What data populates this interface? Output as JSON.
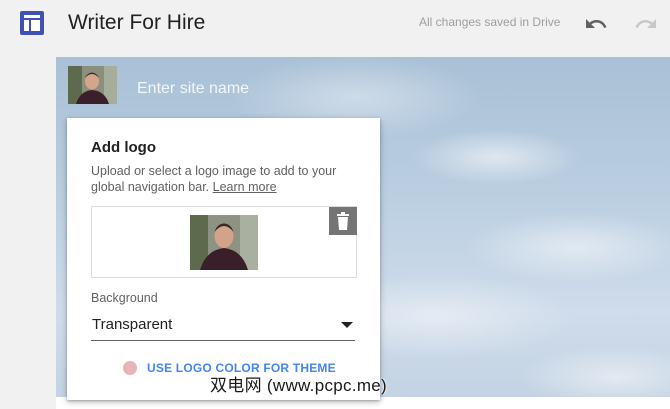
{
  "app": {
    "title": "Writer For Hire",
    "save_status": "All changes saved in Drive",
    "icons": {
      "app": "sites-layout-icon",
      "undo": "undo-icon",
      "redo": "redo-icon"
    }
  },
  "header": {
    "site_name_placeholder": "Enter site name",
    "logo_icon": "portrait-photo-icon"
  },
  "logo_panel": {
    "title": "Add logo",
    "description": "Upload or select a logo image to add to your global navigation bar.",
    "learn_more": "Learn more",
    "delete_icon": "trash-icon",
    "background_label": "Background",
    "background_value": "Transparent",
    "theme_button": "USE LOGO COLOR FOR THEME"
  },
  "colors": {
    "accent": "#4285f4",
    "app_icon": "#3f51b5",
    "theme_dot": "#e8b4b8"
  },
  "watermark": "双电网 (www.pcpc.me)"
}
